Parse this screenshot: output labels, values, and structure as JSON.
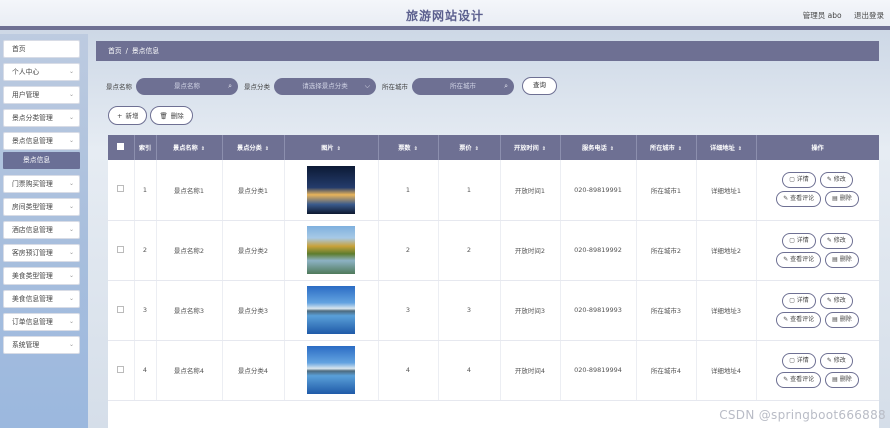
{
  "header": {
    "title": "旅游网站设计",
    "admin": "管理员 abo",
    "logout": "退出登录"
  },
  "sidebar": {
    "items": [
      {
        "label": "首页",
        "chevron": false
      },
      {
        "label": "个人中心",
        "chevron": true
      },
      {
        "label": "用户管理",
        "chevron": true
      },
      {
        "label": "景点分类管理",
        "chevron": true
      },
      {
        "label": "景点信息管理",
        "chevron": true
      },
      {
        "label": "门票购买管理",
        "chevron": true
      },
      {
        "label": "房间类型管理",
        "chevron": true
      },
      {
        "label": "酒店信息管理",
        "chevron": true
      },
      {
        "label": "客房预订管理",
        "chevron": true
      },
      {
        "label": "美食类型管理",
        "chevron": true
      },
      {
        "label": "美食信息管理",
        "chevron": true
      },
      {
        "label": "订单信息管理",
        "chevron": true
      },
      {
        "label": "系统管理",
        "chevron": true
      }
    ],
    "active_sub": "景点信息"
  },
  "breadcrumb": {
    "home": "首页",
    "sep": "/",
    "current": "景点信息"
  },
  "search": {
    "name_label": "景点名称",
    "name_placeholder": "景点名称",
    "category_label": "景点分类",
    "category_placeholder": "请选择景点分类",
    "city_label": "所在城市",
    "city_placeholder": "所在城市",
    "query_button": "查询"
  },
  "actions": {
    "add": "新增",
    "delete": "删除"
  },
  "table": {
    "headers": [
      "索引",
      "景点名称",
      "景点分类",
      "图片",
      "票数",
      "票价",
      "开放时间",
      "服务电话",
      "所在城市",
      "详细地址",
      "操作"
    ],
    "row_buttons": {
      "detail": "详情",
      "edit": "修改",
      "comments": "查看评论",
      "delete": "删除"
    },
    "rows": [
      {
        "index": "1",
        "name": "景点名称1",
        "category": "景点分类1",
        "tickets": "1",
        "price": "1",
        "open": "开放时间1",
        "phone": "020-89819991",
        "city": "所在城市1",
        "address": "详细地址1",
        "image": "night-light"
      },
      {
        "index": "2",
        "name": "景点名称2",
        "category": "景点分类2",
        "tickets": "2",
        "price": "2",
        "open": "开放时间2",
        "phone": "020-89819992",
        "city": "所在城市2",
        "address": "详细地址2",
        "image": "autumn-lake"
      },
      {
        "index": "3",
        "name": "景点名称3",
        "category": "景点分类3",
        "tickets": "3",
        "price": "3",
        "open": "开放时间3",
        "phone": "020-89819993",
        "city": "所在城市3",
        "address": "详细地址3",
        "image": "blue-lake"
      },
      {
        "index": "4",
        "name": "景点名称4",
        "category": "景点分类4",
        "tickets": "4",
        "price": "4",
        "open": "开放时间4",
        "phone": "020-89819994",
        "city": "所在城市4",
        "address": "详细地址4",
        "image": "blue-lake"
      }
    ]
  },
  "watermark": "CSDN @springboot666888",
  "colors": {
    "accent": "#6e7093"
  }
}
